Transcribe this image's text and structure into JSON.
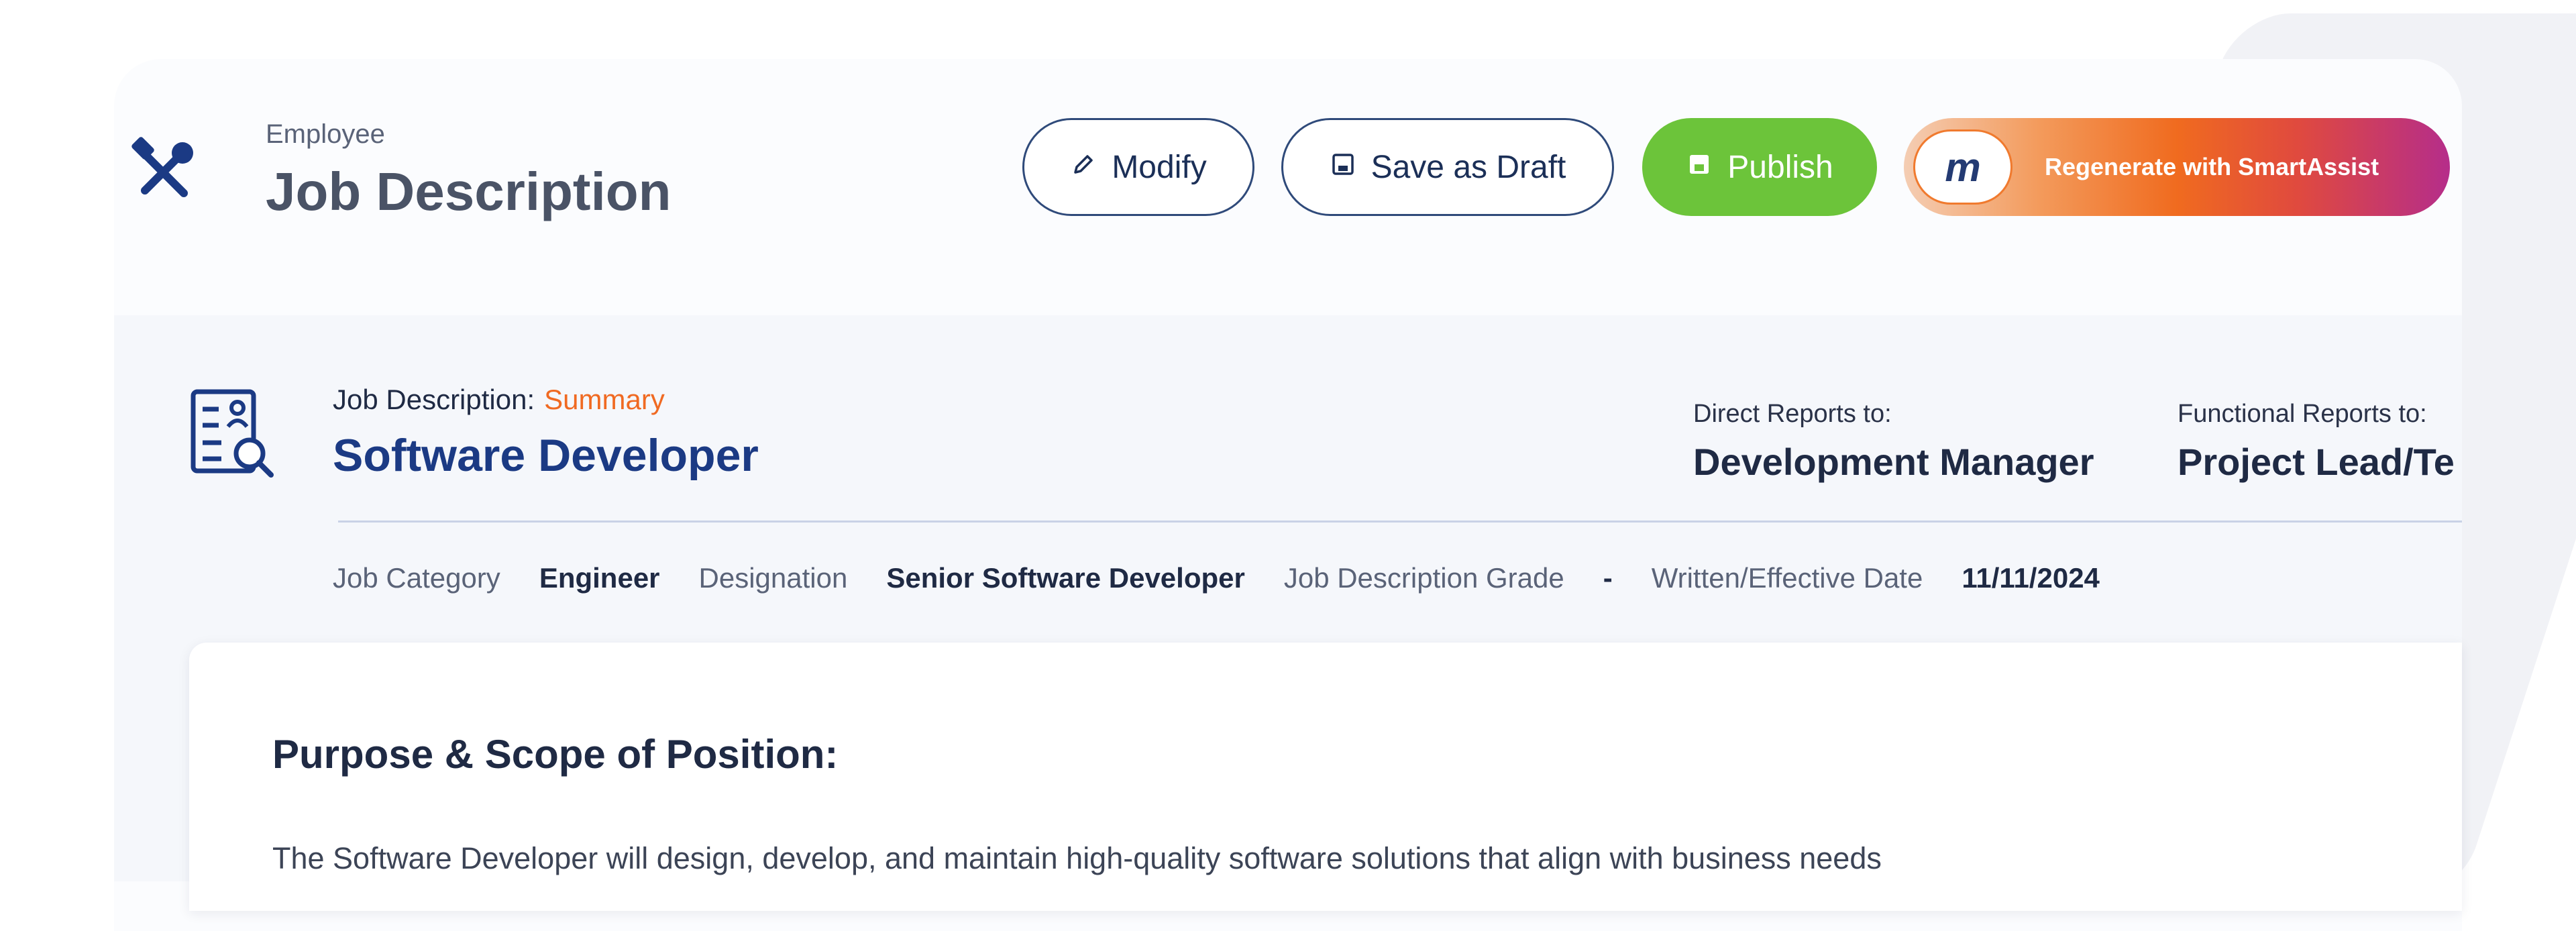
{
  "header": {
    "eyebrow": "Employee",
    "title": "Job Description",
    "icon": "tools-icon"
  },
  "toolbar": {
    "modify_label": "Modify",
    "save_draft_label": "Save as Draft",
    "publish_label": "Publish",
    "smartassist_label": "Regenerate with SmartAssist",
    "smartassist_logo_text": "m"
  },
  "summary": {
    "label": "Job Description:",
    "label_accent": "Summary",
    "job_title": "Software Developer",
    "direct_reports_label": "Direct Reports to:",
    "direct_reports_value": "Development Manager",
    "functional_reports_label": "Functional Reports to:",
    "functional_reports_value": "Project Lead/Te",
    "meta": {
      "job_category_label": "Job Category",
      "job_category_value": "Engineer",
      "designation_label": "Designation",
      "designation_value": "Senior Software Developer",
      "grade_label": "Job Description Grade",
      "grade_value": "-",
      "date_label": "Written/Effective Date",
      "date_value": "11/11/2024"
    }
  },
  "content": {
    "heading": "Purpose & Scope of Position:",
    "body": "The Software Developer will design, develop, and maintain high-quality software solutions that align with business needs"
  },
  "colors": {
    "navy": "#1b3a84",
    "accent_orange": "#f06a22",
    "publish_green": "#6cc43a",
    "smart_gradient_end": "#b52d8a"
  }
}
